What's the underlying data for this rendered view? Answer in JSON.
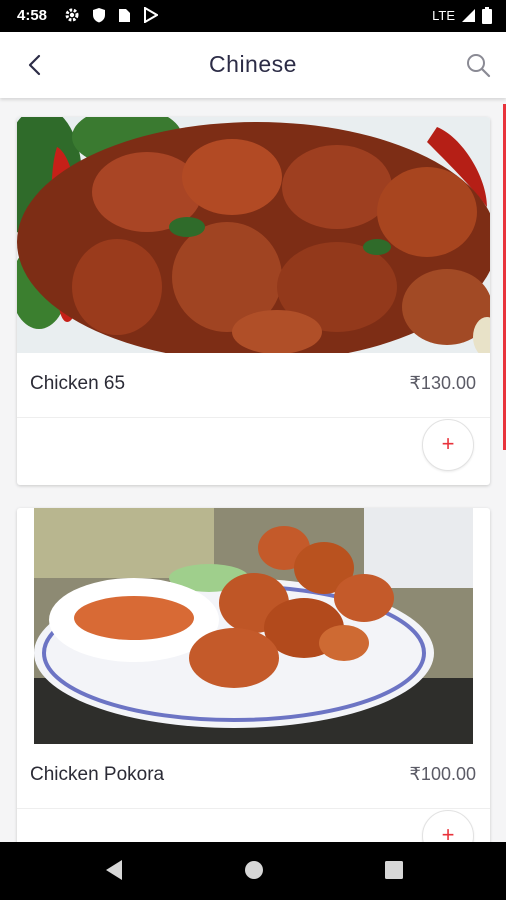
{
  "status_bar": {
    "time": "4:58",
    "network": "LTE",
    "icons": [
      "settings-icon",
      "shield-icon",
      "sim-card-icon",
      "play-store-icon",
      "signal-icon",
      "battery-icon"
    ]
  },
  "header": {
    "title": "Chinese",
    "back_icon": "arrow-back-icon",
    "search_icon": "search-icon"
  },
  "items": [
    {
      "name": "Chicken 65",
      "price": "₹130.00",
      "add_label": "+"
    },
    {
      "name": "Chicken Pokora",
      "price": "₹100.00",
      "add_label": "+"
    }
  ],
  "nav": {
    "buttons": [
      "back-triangle-icon",
      "home-circle-icon",
      "recents-square-icon"
    ]
  },
  "colors": {
    "accent": "#e8333b",
    "title": "#2c2c46"
  }
}
